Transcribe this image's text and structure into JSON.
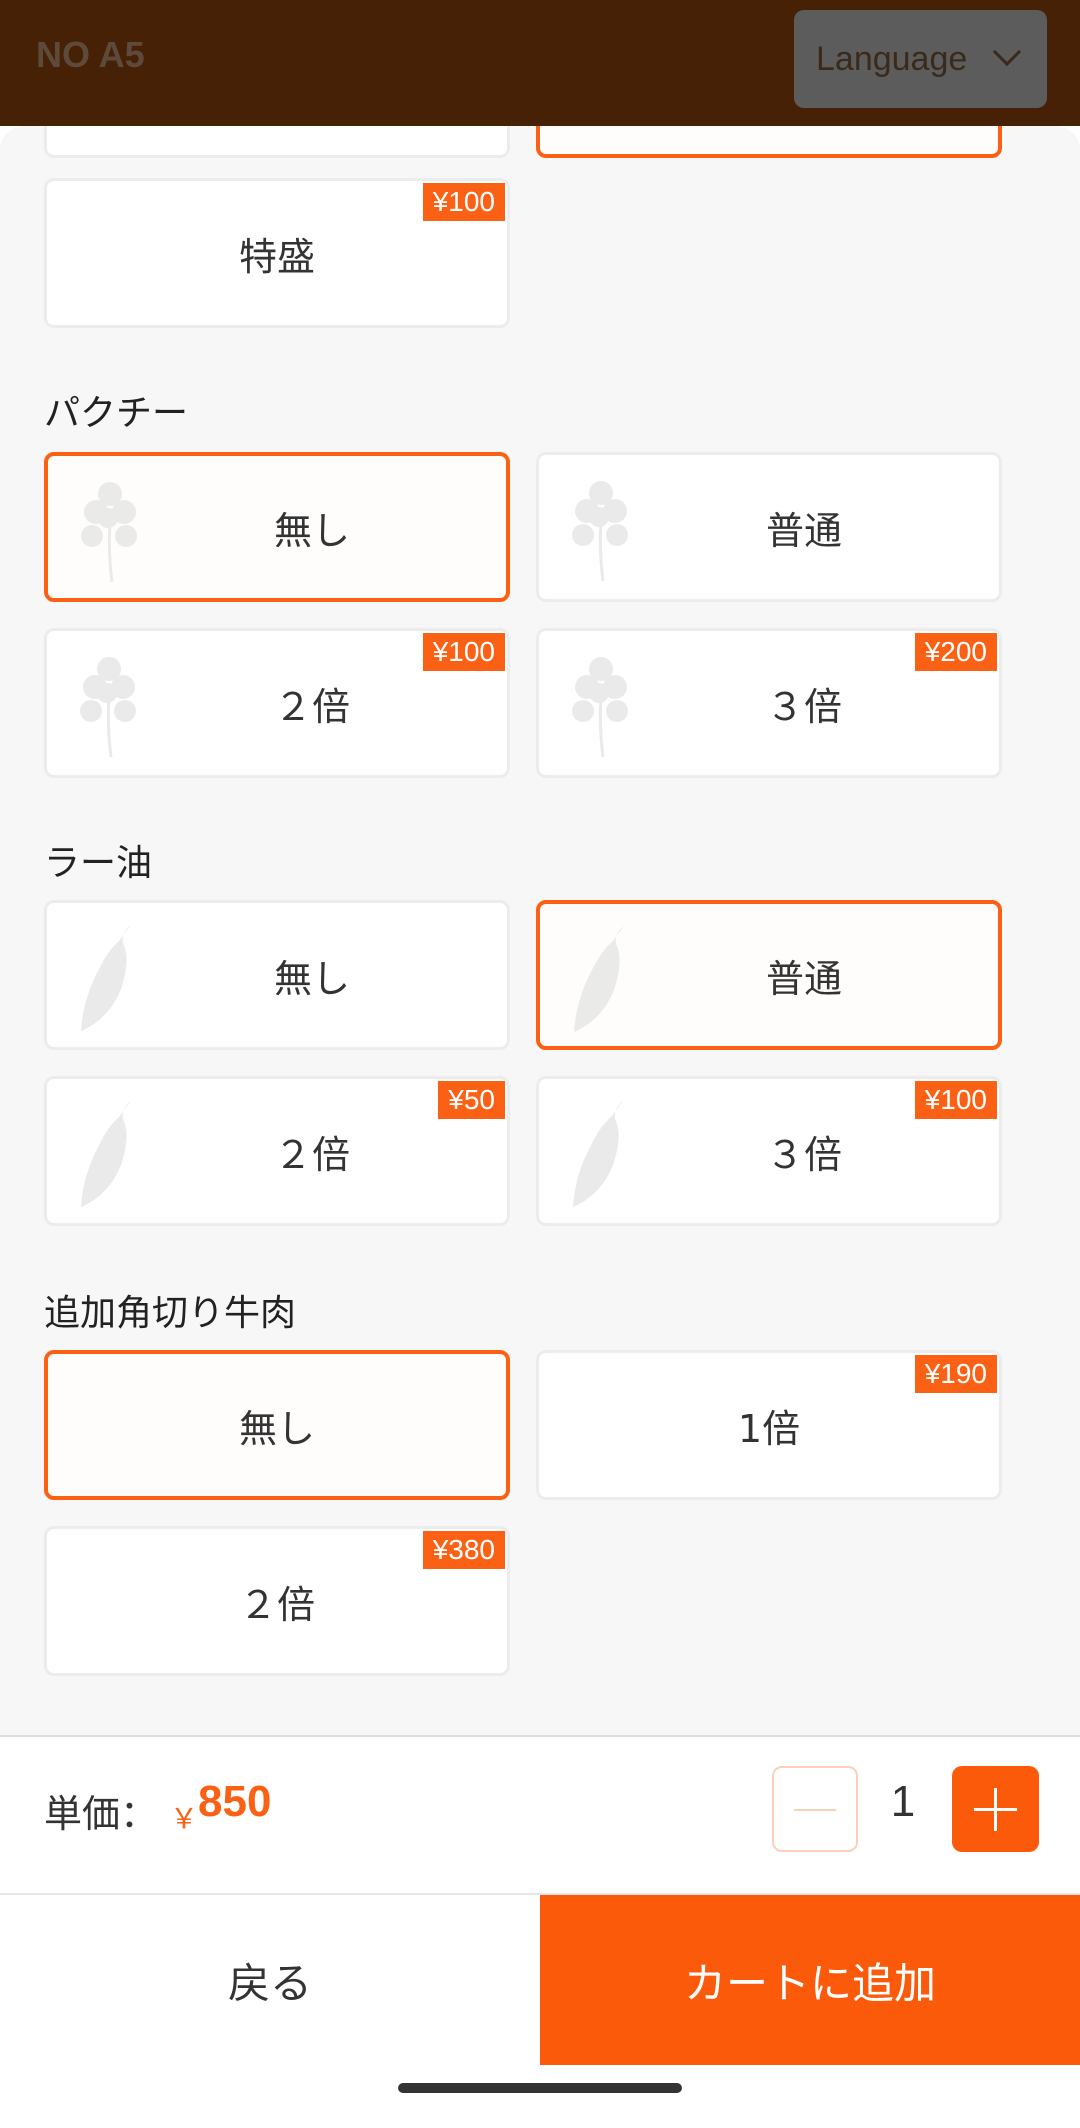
{
  "header": {
    "table_no": "NO A5",
    "language_label": "Language"
  },
  "sections": {
    "size": {
      "special_label": "特盛",
      "special_price": "¥100"
    },
    "coriander": {
      "title": "パクチー",
      "options": [
        {
          "label": "無し",
          "price": "",
          "selected": true
        },
        {
          "label": "普通",
          "price": "",
          "selected": false
        },
        {
          "label": "２倍",
          "price": "¥100",
          "selected": false
        },
        {
          "label": "３倍",
          "price": "¥200",
          "selected": false
        }
      ]
    },
    "chili_oil": {
      "title": "ラー油",
      "options": [
        {
          "label": "無し",
          "price": "",
          "selected": false
        },
        {
          "label": "普通",
          "price": "",
          "selected": true
        },
        {
          "label": "２倍",
          "price": "¥50",
          "selected": false
        },
        {
          "label": "３倍",
          "price": "¥100",
          "selected": false
        }
      ]
    },
    "extra_beef": {
      "title": "追加角切り牛肉",
      "options": [
        {
          "label": "無し",
          "price": "",
          "selected": true
        },
        {
          "label": "1倍",
          "price": "¥190",
          "selected": false
        },
        {
          "label": "２倍",
          "price": "¥380",
          "selected": false
        }
      ]
    }
  },
  "footer": {
    "unit_price_label": "単価：",
    "currency": "￥",
    "unit_price": "850",
    "quantity": "1"
  },
  "actions": {
    "back_label": "戻る",
    "add_to_cart_label": "カートに追加"
  },
  "colors": {
    "accent": "#fa6114",
    "header_bg": "#472105",
    "sheet_bg": "#f7f7f7"
  },
  "icons": {
    "coriander": "coriander-leaf-icon",
    "chili": "chili-pepper-icon"
  }
}
